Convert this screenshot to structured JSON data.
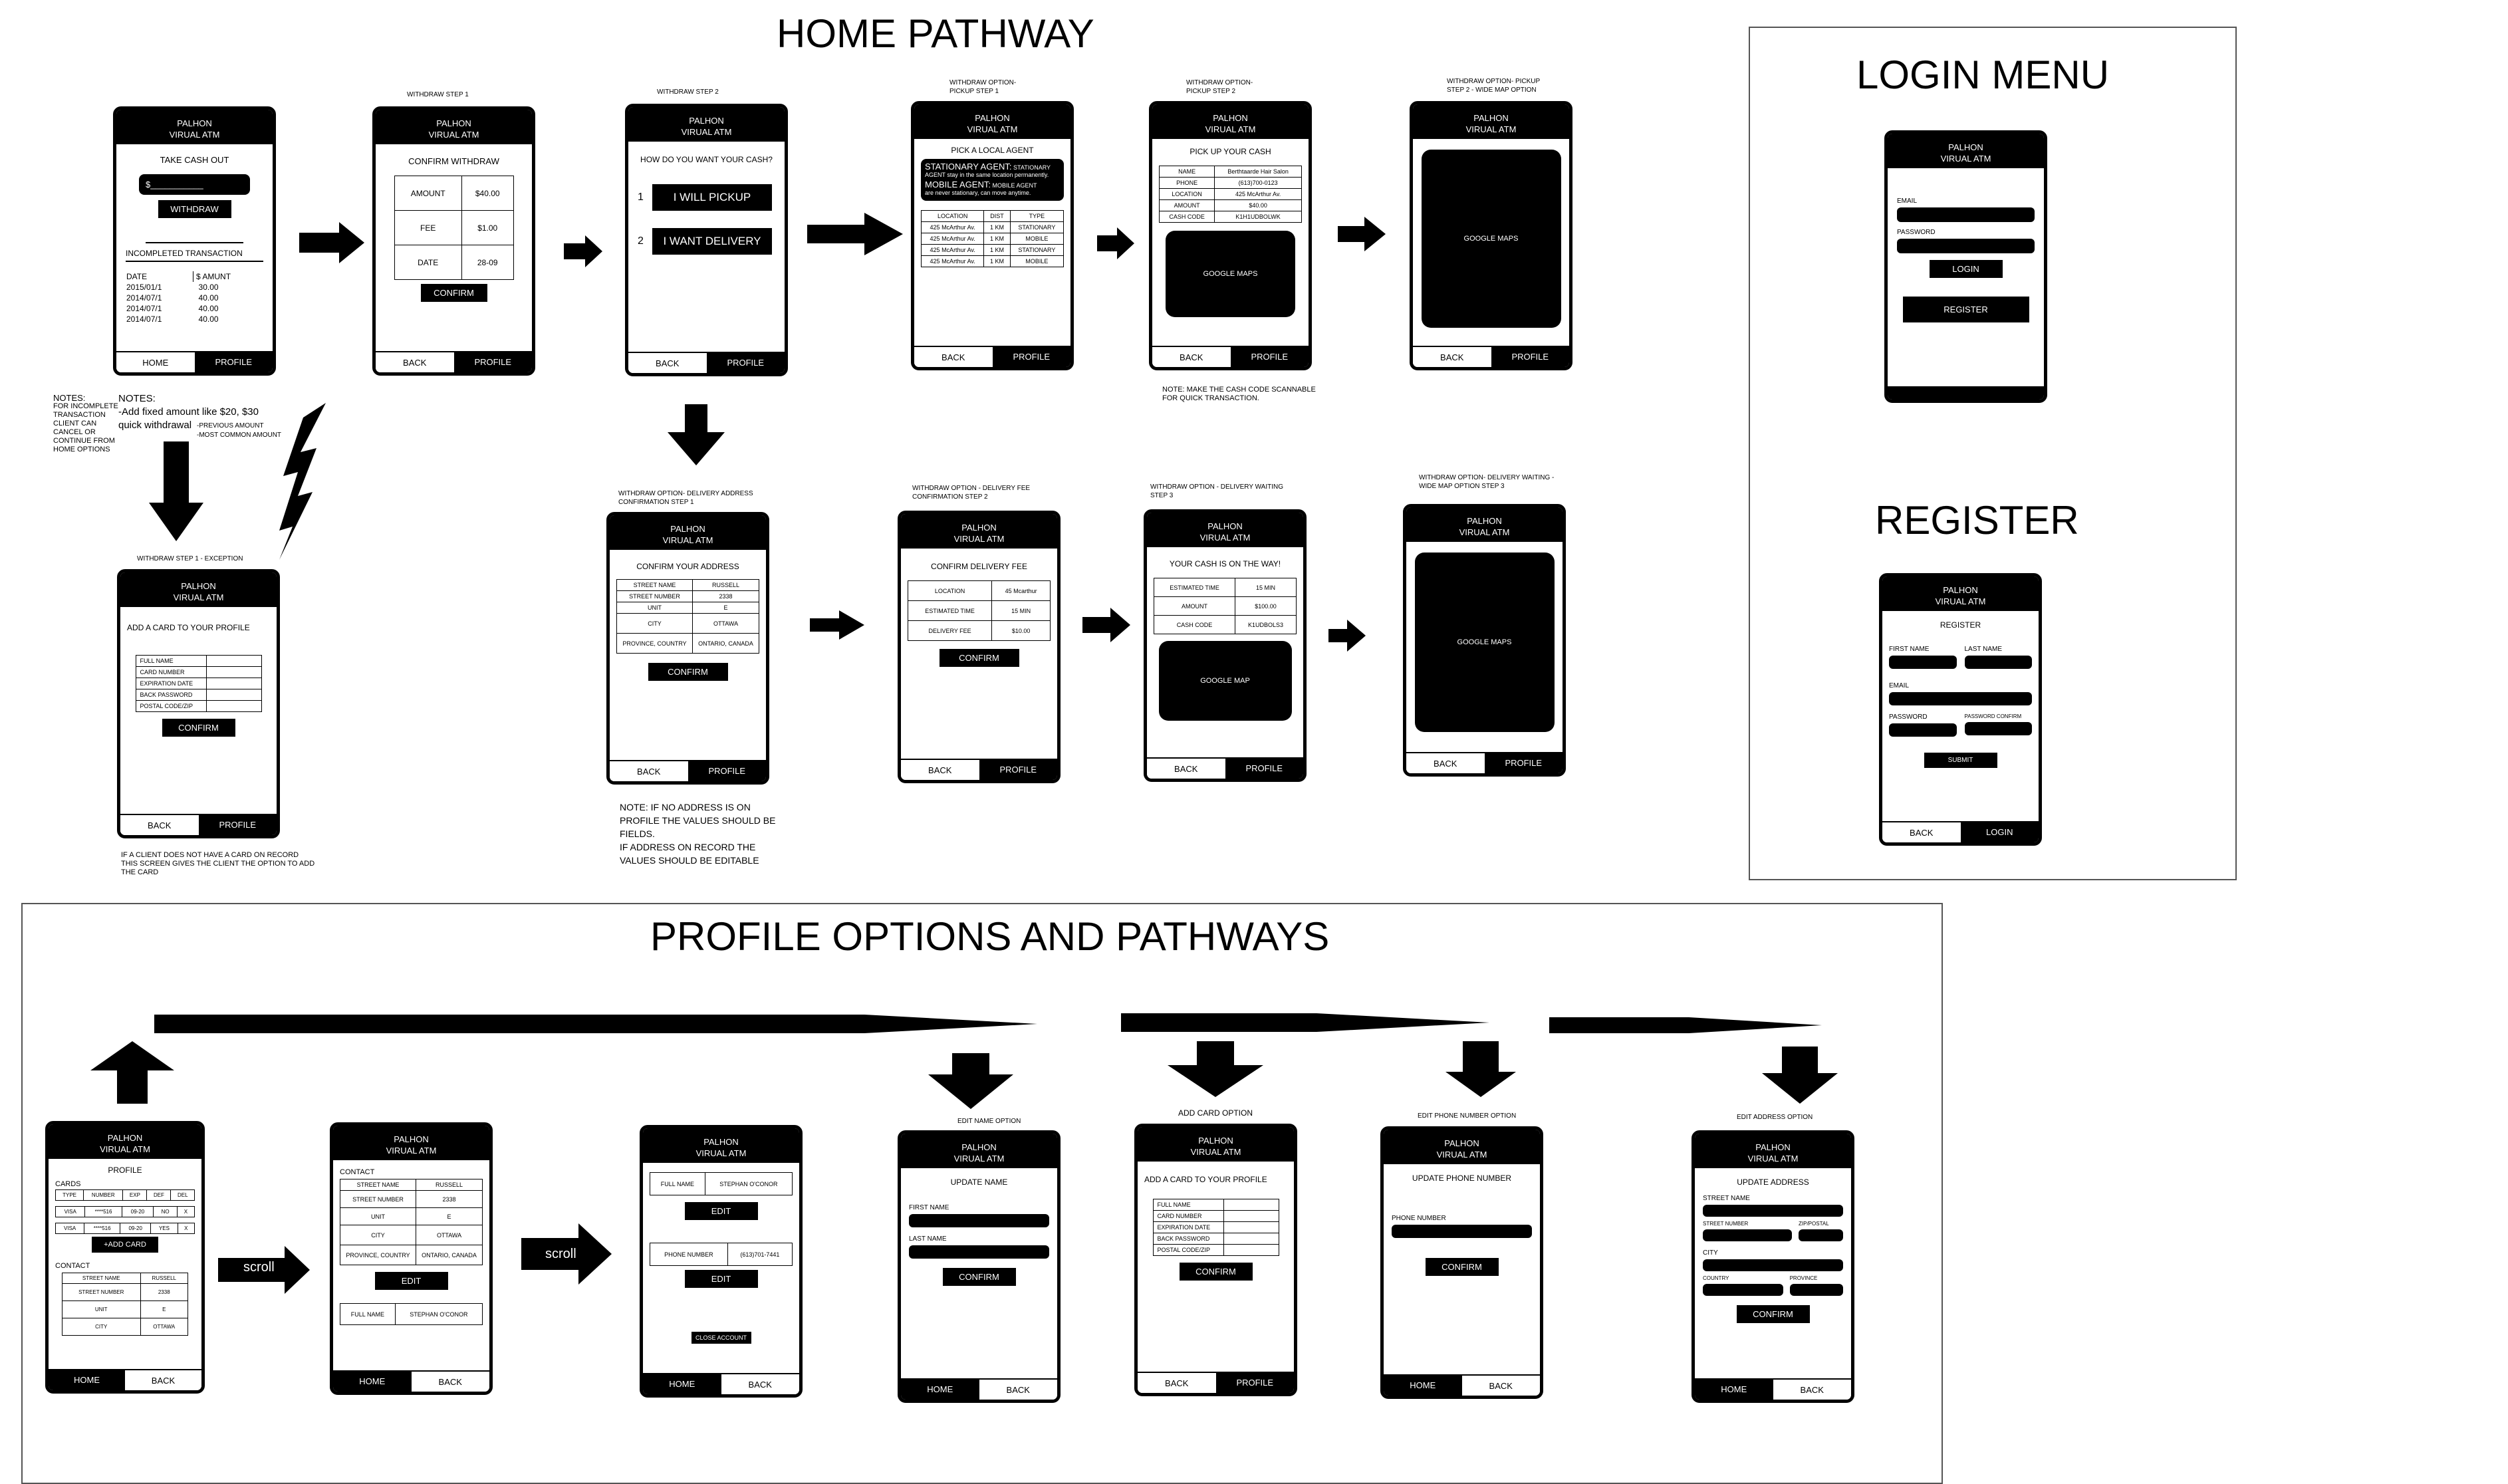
{
  "titles": {
    "home": "HOME PATHWAY",
    "login": "LOGIN MENU",
    "register": "REGISTER",
    "profile": "PROFILE OPTIONS AND PATHWAYS"
  },
  "app": {
    "name1": "PALHON",
    "name2": "VIRUAL ATM"
  },
  "labels": {
    "home": "HOME",
    "profile": "PROFILE",
    "back": "BACK",
    "login": "LOGIN",
    "confirm": "CONFIRM",
    "edit": "EDIT",
    "google_maps": "GOOGLE MAPS",
    "google_map": "GOOGLE MAP",
    "scroll": "scroll"
  },
  "captions": {
    "w1": "WITHDRAW STEP 1",
    "w2": "WITHDRAW STEP 2",
    "p1a": "WITHDRAW OPTION-",
    "p1b": "PICKUP STEP 1",
    "p2a": "WITHDRAW OPTION-",
    "p2b": "PICKUP STEP 2",
    "p3a": "WITHDRAW OPTION- PICKUP",
    "p3b": "STEP 2 - WIDE MAP OPTION",
    "exc": "WITHDRAW STEP 1 - EXCEPTION",
    "d1a": "WITHDRAW OPTION- DELIVERY ADDRESS",
    "d1b": "CONFIRMATION STEP 1",
    "d2a": "WITHDRAW OPTION - DELIVERY FEE",
    "d2b": "CONFIRMATION STEP 2",
    "d3a": "WITHDRAW OPTION - DELIVERY WAITING",
    "d3b": "STEP 3",
    "d4a": "WITHDRAW OPTION- DELIVERY WAITING -",
    "d4b": "WIDE MAP OPTION STEP 3",
    "edit_name": "EDIT NAME OPTION",
    "add_card": "ADD CARD OPTION",
    "edit_phone": "EDIT PHONE NUMBER OPTION",
    "edit_address": "EDIT ADDRESS OPTION"
  },
  "notes": {
    "left_title": "NOTES:",
    "left_body": [
      "FOR INCOMPLETE",
      "TRANSACTION",
      "CLIENT CAN",
      "CANCEL OR",
      "CONTINUE FROM",
      "HOME OPTIONS"
    ],
    "mid_title": "NOTES:",
    "mid_body": "-Add fixed amount like $20, $30",
    "mid_body2": "quick withdrawal",
    "mid_side1": "-PREVIOUS AMOUNT",
    "mid_side2": "-MOST COMMON AMOUNT",
    "cash_code": [
      "NOTE: MAKE THE CASH CODE SCANNABLE",
      "FOR QUICK TRANSACTION."
    ],
    "address": [
      "NOTE: IF NO ADDRESS IS ON",
      "PROFILE THE VALUES SHOULD BE",
      "FIELDS.",
      "IF ADDRESS ON RECORD THE",
      "VALUES SHOULD BE EDITABLE"
    ],
    "card": [
      "IF A CLIENT DOES NOT HAVE A CARD ON RECORD",
      "THIS SCREEN GIVES THE CLIENT THE OPTION TO ADD",
      "THE CARD"
    ]
  },
  "screens": {
    "home": {
      "heading": "TAKE CASH OUT",
      "amount": "$___________",
      "withdraw": "WITHDRAW",
      "incomplete": "INCOMPLETED TRANSACTION",
      "col_date": "DATE",
      "col_amount": "$ AMUNT",
      "rows": [
        [
          "2015/01/1",
          "30.00"
        ],
        [
          "2014/07/1",
          "40.00"
        ],
        [
          "2014/07/1",
          "40.00"
        ],
        [
          "2014/07/1",
          "40.00"
        ]
      ]
    },
    "confirm_withdraw": {
      "heading": "CONFIRM WITHDRAW",
      "rows": [
        [
          "AMOUNT",
          "$40.00"
        ],
        [
          "FEE",
          "$1.00"
        ],
        [
          "DATE",
          "28-09"
        ]
      ]
    },
    "how": {
      "heading": "HOW DO YOU WANT YOUR CASH?",
      "n1": "1",
      "opt1": "I WILL PICKUP",
      "n2": "2",
      "opt2": "I WANT DELIVERY"
    },
    "agent": {
      "heading": "PICK A LOCAL AGENT",
      "st_title": "STATIONARY AGENT:",
      "st_small": "STATIONARY",
      "st_desc": "AGENT stay in the same location permanently.",
      "mo_title": "MOBILE AGENT:",
      "mo_small": "MOBILE AGENT",
      "mo_desc": "are never stationary, can move anytime.",
      "cols": [
        "LOCATION",
        "DIST",
        "TYPE"
      ],
      "rows": [
        [
          "425 McArthur Av.",
          "1 KM",
          "STATIONARY"
        ],
        [
          "425 McArthur Av.",
          "1 KM",
          "MOBILE"
        ],
        [
          "425 McArthur Av.",
          "1 KM",
          "STATIONARY"
        ],
        [
          "425 McArthur Av.",
          "1 KM",
          "MOBILE"
        ]
      ]
    },
    "pickup": {
      "heading": "PICK UP YOUR CASH",
      "rows": [
        [
          "NAME",
          "Berthtaarde Hair Salon"
        ],
        [
          "PHONE",
          "(613)700-0123"
        ],
        [
          "LOCATION",
          "425 McArthur Av."
        ],
        [
          "AMOUNT",
          "$40.00"
        ],
        [
          "CASH CODE",
          "K1H1UDBOLWK"
        ]
      ]
    },
    "add_card_exc": {
      "heading": "ADD A CARD TO YOUR PROFILE",
      "fields": [
        "FULL NAME",
        "CARD NUMBER",
        "EXPIRATION DATE",
        "BACK PASSWORD",
        "POSTAL CODE/ZIP"
      ]
    },
    "address": {
      "heading": "CONFIRM YOUR ADDRESS",
      "rows": [
        [
          "STREET NAME",
          "RUSSELL"
        ],
        [
          "STREET NUMBER",
          "2338"
        ],
        [
          "UNIT",
          "E"
        ],
        [
          "CITY",
          "OTTAWA"
        ],
        [
          "PROVINCE, COUNTRY",
          "ONTARIO, CANADA"
        ]
      ]
    },
    "fee": {
      "heading": "CONFIRM DELIVERY FEE",
      "rows": [
        [
          "LOCATION",
          "45 Mcarthur"
        ],
        [
          "ESTIMATED TIME",
          "15 MIN"
        ],
        [
          "DELIVERY FEE",
          "$10.00"
        ]
      ]
    },
    "onway": {
      "heading": "YOUR CASH IS ON THE WAY!",
      "rows": [
        [
          "ESTIMATED TIME",
          "15 MIN"
        ],
        [
          "AMOUNT",
          "$100.00"
        ],
        [
          "CASH CODE",
          "K1UDBOLS3"
        ]
      ]
    },
    "login": {
      "email": "EMAIL",
      "password": "PASSWORD",
      "login": "LOGIN",
      "register": "REGISTER"
    },
    "register": {
      "heading": "REGISTER",
      "first": "FIRST NAME",
      "last": "LAST NAME",
      "email": "EMAIL",
      "password": "PASSWORD",
      "password_confirm": "PASSWORD CONFIRM",
      "submit": "SUBMIT"
    },
    "profile": {
      "heading": "PROFILE",
      "cards": "CARDS",
      "card_cols": [
        "TYPE",
        "NUMBER",
        "EXP",
        "DEF",
        "DEL"
      ],
      "card_rows": [
        [
          "VISA",
          "****516",
          "09-20",
          "NO",
          "X"
        ],
        [
          "VISA",
          "****516",
          "09-20",
          "YES",
          "X"
        ]
      ],
      "add_card": "+ADD CARD",
      "contact": "CONTACT",
      "contact_rows": [
        [
          "STREET NAME",
          "RUSSELL"
        ],
        [
          "STREET NUMBER",
          "2338"
        ],
        [
          "UNIT",
          "E"
        ],
        [
          "CITY",
          "OTTAWA"
        ]
      ]
    },
    "contact2": {
      "heading": "CONTACT",
      "rows": [
        [
          "STREET NAME",
          "RUSSELL"
        ],
        [
          "STREET NUMBER",
          "2338"
        ],
        [
          "UNIT",
          "E"
        ],
        [
          "CITY",
          "OTTAWA"
        ],
        [
          "PROVINCE, COUNTRY",
          "ONTARIO, CANADA"
        ]
      ],
      "name_label": "FULL NAME",
      "name_value": "STEPHAN O'CONOR"
    },
    "contact3": {
      "name_label": "FULL NAME",
      "name_value": "STEPHAN O'CONOR",
      "phone_label": "PHONE NUMBER",
      "phone_value": "(613)701-7441",
      "close": "CLOSE ACCOUNT"
    },
    "update_name": {
      "heading": "UPDATE NAME",
      "first": "FIRST NAME",
      "last": "LAST NAME"
    },
    "update_phone": {
      "heading": "UPDATE PHONE NUMBER",
      "phone": "PHONE NUMBER"
    },
    "update_address": {
      "heading": "UPDATE ADDRESS",
      "street_name": "STREET NAME",
      "street_number": "STREET NUMBER",
      "zip": "ZIP/POSTAL",
      "city": "CITY",
      "country": "COUNTRY",
      "province": "PROVINCE"
    }
  }
}
